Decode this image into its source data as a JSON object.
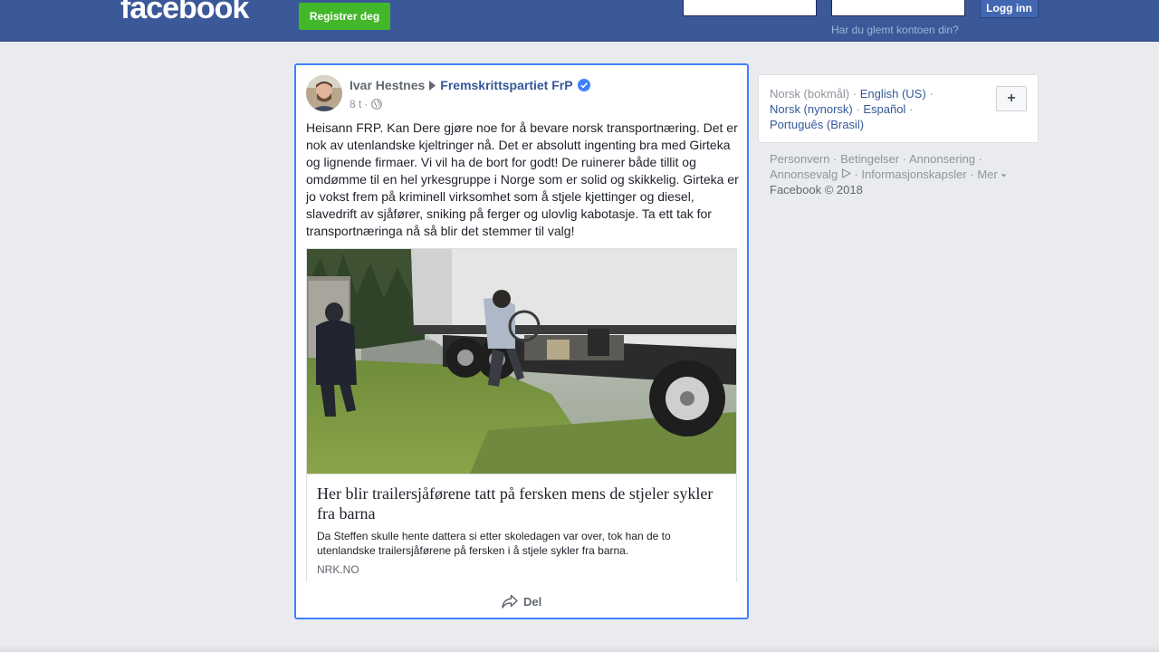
{
  "header": {
    "logo": "facebook",
    "register_label": "Registrer deg",
    "login_label": "Logg inn",
    "forgot_label": "Har du glemt kontoen din?",
    "bg_color": "#3b5998"
  },
  "post": {
    "author": "Ivar Hestnes",
    "page": "Fremskrittspartiet FrP",
    "time": "8 t",
    "time_separator": "·",
    "text": "Heisann FRP. Kan Dere gjøre noe for å bevare norsk transportnæring. Det er nok av utenlandske kjeltringer nå. Det er absolutt ingenting bra med Girteka og lignende firmaer. Vi vil ha de bort for godt! De ruinerer både tillit og omdømme til en hel yrkesgruppe i Norge som er solid og skikkelig. Girteka er jo vokst frem på kriminell virksomhet som å stjele kjettinger og diesel, slavedrift av sjåfører, sniking på ferger og ulovlig kabotasje. Ta ett tak for transportnæringa nå så blir det stemmer til valg!",
    "link": {
      "title": "Her blir trailersjåførene tatt på fersken mens de stjeler sykler fra barna",
      "description": "Da Steffen skulle hente dattera si etter skoledagen var over, tok han de to utenlandske trailersjåførene på fersken i å stjele sykler fra barna.",
      "domain": "NRK.NO"
    },
    "share_label": "Del",
    "highlight_color": "#4080ff"
  },
  "sidebar": {
    "current_language": "Norsk (bokmål)",
    "languages": [
      "English (US)",
      "Norsk (nynorsk)",
      "Español",
      "Português (Brasil)"
    ],
    "separator": "·",
    "add_label": "+",
    "footer": [
      "Personvern",
      "Betingelser",
      "Annonsering",
      "Annonsevalg",
      "Informasjonskapsler",
      "Mer"
    ],
    "copyright": "Facebook © 2018"
  }
}
